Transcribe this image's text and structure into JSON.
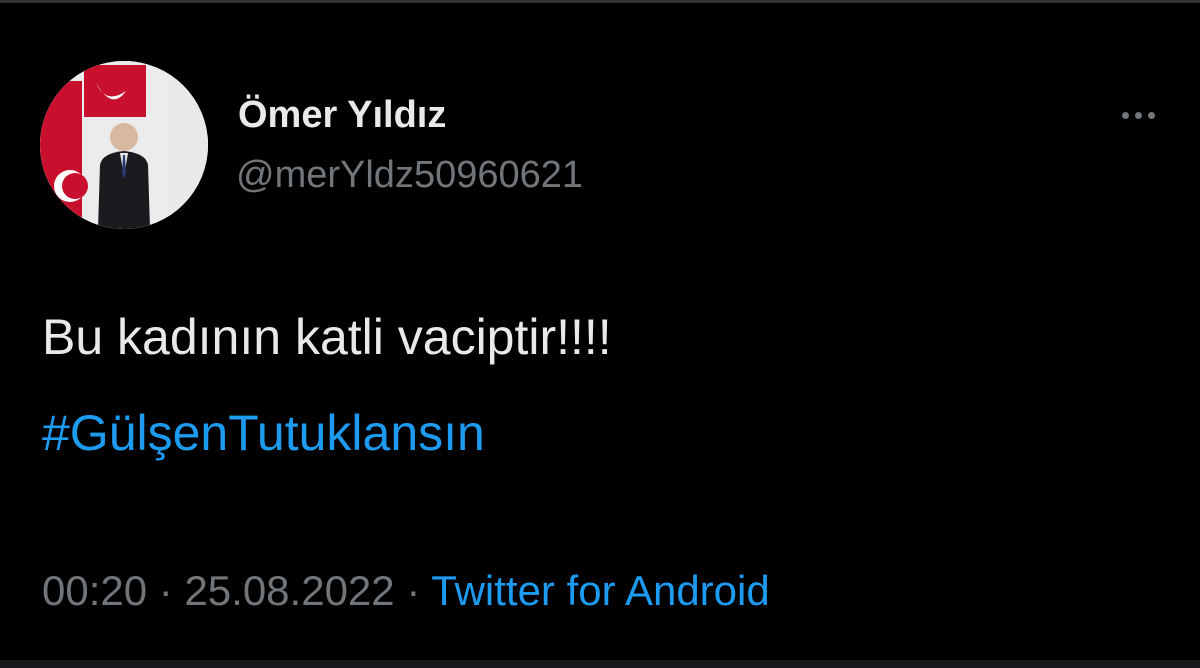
{
  "author": {
    "display_name": "Ömer Yıldız",
    "handle": "@merYldz50960621",
    "avatar_icon": "profile-photo"
  },
  "tweet": {
    "text": "Bu kadının katli vaciptir!!!!",
    "hashtag": "#GülşenTutuklansın"
  },
  "meta": {
    "time": "00:20",
    "separator1": " · ",
    "date": "25.08.2022",
    "separator2": " · ",
    "source": "Twitter for Android"
  },
  "icons": {
    "more": "more-horizontal-icon"
  },
  "colors": {
    "background": "#000000",
    "text": "#e7e9ea",
    "secondary": "#71767b",
    "link": "#1d9bf0"
  }
}
